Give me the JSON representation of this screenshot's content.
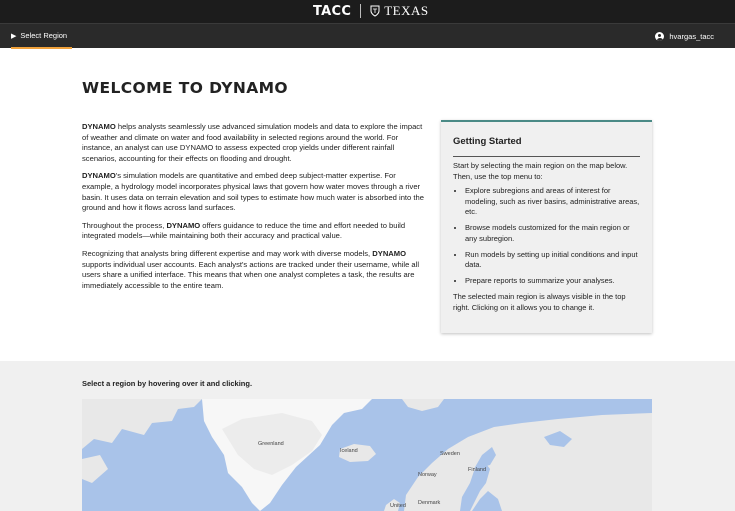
{
  "header": {
    "logo_left": "TACC",
    "logo_right": "TEXAS"
  },
  "nav": {
    "region_label": "Select Region",
    "user_name": "hvargas_tacc"
  },
  "page": {
    "title": "WELCOME TO DYNAMO"
  },
  "intro": {
    "p1_bold": "DYNAMO",
    "p1_text": " helps analysts seamlessly use advanced simulation models and data to explore the impact of weather and climate on water and food availability in selected regions around the world. For instance, an analyst can use DYNAMO to assess expected crop yields under different rainfall scenarios, accounting for their effects on flooding and drought.",
    "p2_bold": "DYNAMO",
    "p2_text": "'s simulation models are quantitative and embed deep subject-matter expertise. For example, a hydrology model incorporates physical laws that govern how water moves through a river basin. It uses data on terrain elevation and soil types to estimate how much water is absorbed into the ground and how it flows across land surfaces.",
    "p3_pre": "Throughout the process, ",
    "p3_bold": "DYNAMO",
    "p3_text": " offers guidance to reduce the time and effort needed to build integrated models—while maintaining both their accuracy and practical value.",
    "p4_pre": "Recognizing that analysts bring different expertise and may work with diverse models, ",
    "p4_bold": "DYNAMO",
    "p4_text": " supports individual user accounts. Each analyst's actions are tracked under their username, while all users share a unified interface. This means that when one analyst completes a task, the results are immediately accessible to the entire team."
  },
  "getting_started": {
    "title": "Getting Started",
    "lead": "Start by selecting the main region on the map below. Then, use the top menu to:",
    "items": [
      "Explore subregions and areas of interest for modeling, such as river basins, administrative areas, etc.",
      "Browse models customized for the main region or any subregion.",
      "Run models by setting up initial conditions and input data.",
      "Prepare reports to summarize your analyses."
    ],
    "footer": "The selected main region is always visible in the top right. Clicking on it allows you to change it."
  },
  "map_section": {
    "instruction": "Select a region by hovering over it and clicking.",
    "labels": {
      "greenland": "Greenland",
      "iceland": "Iceland",
      "sweden": "Sweden",
      "finland": "Finland",
      "norway": "Norway",
      "denmark": "Denmark",
      "united": "United"
    },
    "colors": {
      "water": "#a9c3e9",
      "land": "#e8e8e8",
      "ice": "#f7f7f7"
    }
  },
  "colors": {
    "topbar": "#1c1c1c",
    "navbar": "#2a2a2a",
    "nav_accent": "#f0a23c",
    "card_accent": "#4a8a86"
  }
}
